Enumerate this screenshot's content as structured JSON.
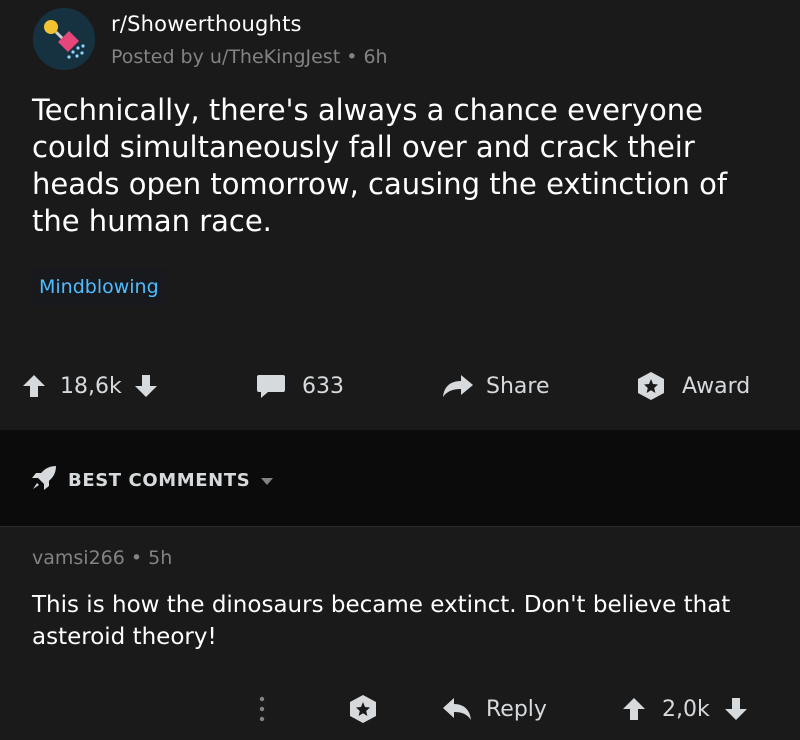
{
  "post": {
    "subreddit": "r/Showerthoughts",
    "posted_by": "Posted by u/TheKingJest",
    "age": "6h",
    "title": "Technically, there's always a chance everyone could simultaneously fall over and crack their heads open tomorrow, causing the extinction of the human race.",
    "flair": "Mindblowing",
    "votes": "18,6k",
    "comments_count": "633",
    "share_label": "Share",
    "award_label": "Award"
  },
  "sort": {
    "label": "BEST COMMENTS"
  },
  "comment": {
    "author": "vamsi266",
    "age": "5h",
    "body": "This is how the dinosaurs became extinct. Don't believe that asteroid theory!",
    "reply_label": "Reply",
    "votes": "2,0k"
  },
  "colors": {
    "background": "#1a1a1b",
    "flair_text": "#4fbcff",
    "muted": "#818384"
  }
}
